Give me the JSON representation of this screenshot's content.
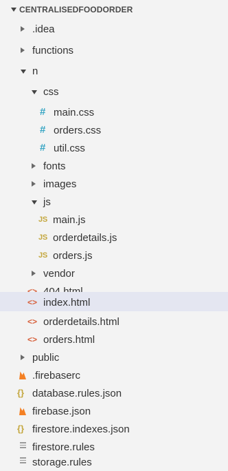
{
  "explorer": {
    "root_title": "CENTRALISEDFOODORDER",
    "items": [
      {
        "label": ".idea",
        "type": "folder",
        "expanded": false
      },
      {
        "label": "functions",
        "type": "folder",
        "expanded": false
      },
      {
        "label": "n",
        "type": "folder",
        "expanded": true
      },
      {
        "label": "css",
        "type": "folder",
        "expanded": true
      },
      {
        "label": "main.css",
        "type": "css",
        "icon": "#"
      },
      {
        "label": "orders.css",
        "type": "css",
        "icon": "#"
      },
      {
        "label": "util.css",
        "type": "css",
        "icon": "#"
      },
      {
        "label": "fonts",
        "type": "folder",
        "expanded": false
      },
      {
        "label": "images",
        "type": "folder",
        "expanded": false
      },
      {
        "label": "js",
        "type": "folder",
        "expanded": true
      },
      {
        "label": "main.js",
        "type": "js",
        "icon": "JS"
      },
      {
        "label": "orderdetails.js",
        "type": "js",
        "icon": "JS"
      },
      {
        "label": "orders.js",
        "type": "js",
        "icon": "JS"
      },
      {
        "label": "vendor",
        "type": "folder",
        "expanded": false
      },
      {
        "label": "404.html",
        "type": "html",
        "icon": "<>"
      },
      {
        "label": "index.html",
        "type": "html",
        "icon": "<>",
        "selected": true
      },
      {
        "label": "orderdetails.html",
        "type": "html",
        "icon": "<>"
      },
      {
        "label": "orders.html",
        "type": "html",
        "icon": "<>"
      },
      {
        "label": "public",
        "type": "folder",
        "expanded": false
      },
      {
        "label": ".firebaserc",
        "type": "firebase"
      },
      {
        "label": "database.rules.json",
        "type": "json",
        "icon": "{}"
      },
      {
        "label": "firebase.json",
        "type": "firebase"
      },
      {
        "label": "firestore.indexes.json",
        "type": "json",
        "icon": "{}"
      },
      {
        "label": "firestore.rules",
        "type": "rules"
      },
      {
        "label": "storage.rules",
        "type": "rules"
      }
    ]
  },
  "colors": {
    "background": "#f3f3f3",
    "selected_row": "#e4e6f1",
    "css_icon": "#38a6c4",
    "js_icon": "#c4a73e",
    "html_icon": "#d7623e",
    "json_icon": "#c4a73e",
    "firebase_icon": "#f48024",
    "rules_icon": "#9a9a9a"
  }
}
